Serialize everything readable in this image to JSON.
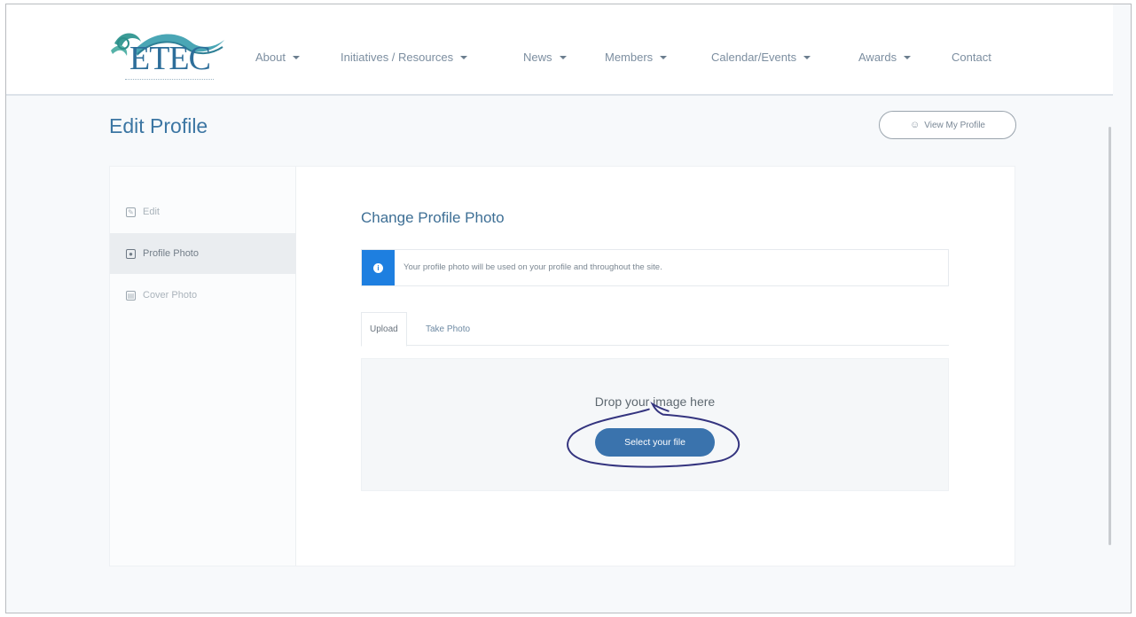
{
  "header": {
    "logo_text": "ETEC",
    "nav": [
      {
        "label": "About",
        "dropdown": true
      },
      {
        "label": "Initiatives / Resources",
        "dropdown": true
      },
      {
        "label": "News",
        "dropdown": true
      },
      {
        "label": "Members",
        "dropdown": true
      },
      {
        "label": "Calendar/Events",
        "dropdown": true
      },
      {
        "label": "Awards",
        "dropdown": true
      },
      {
        "label": "Contact",
        "dropdown": false
      }
    ]
  },
  "page": {
    "title": "Edit Profile",
    "view_profile_label": "View My Profile"
  },
  "sidebar": {
    "items": [
      {
        "label": "Edit",
        "icon": "edit-icon",
        "active": false
      },
      {
        "label": "Profile Photo",
        "icon": "profile-photo-icon",
        "active": true
      },
      {
        "label": "Cover Photo",
        "icon": "cover-photo-icon",
        "active": false
      }
    ]
  },
  "main": {
    "section_title": "Change Profile Photo",
    "notice": "Your profile photo will be used on your profile and throughout the site.",
    "tabs": [
      {
        "label": "Upload",
        "active": true
      },
      {
        "label": "Take Photo",
        "active": false
      }
    ],
    "dropzone": {
      "text": "Drop your image here",
      "button_label": "Select your file"
    }
  },
  "colors": {
    "brand": "#3c76a3",
    "button": "#3a73ad",
    "info": "#1e7fe0",
    "annotation_ink": "#3a3a8c"
  }
}
